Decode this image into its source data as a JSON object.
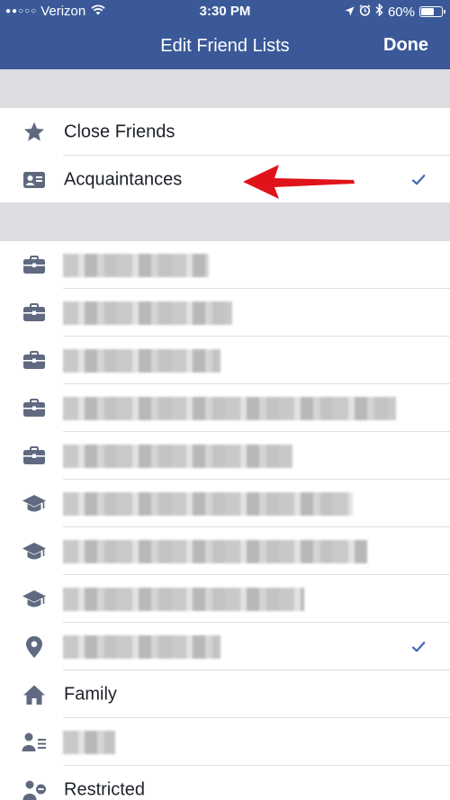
{
  "status_bar": {
    "carrier": "Verizon",
    "time": "3:30 PM",
    "battery": "60%",
    "battery_level": 0.6,
    "icons": [
      "signal-dots-icon",
      "wifi-icon",
      "location-icon",
      "alarm-icon",
      "bluetooth-icon",
      "battery-icon"
    ]
  },
  "nav": {
    "title": "Edit Friend Lists",
    "done_label": "Done",
    "bar_color": "#3b5998"
  },
  "section1": {
    "rows": [
      {
        "label": "Close Friends",
        "icon": "star-icon",
        "checked": false
      },
      {
        "label": "Acquaintances",
        "icon": "contact-card-icon",
        "checked": true
      }
    ]
  },
  "section2": {
    "rows": [
      {
        "label": "",
        "icon": "briefcase-icon",
        "checked": false,
        "blurred": true
      },
      {
        "label": "",
        "icon": "briefcase-icon",
        "checked": false,
        "blurred": true
      },
      {
        "label": "",
        "icon": "briefcase-icon",
        "checked": false,
        "blurred": true
      },
      {
        "label": "",
        "icon": "briefcase-icon",
        "checked": false,
        "blurred": true
      },
      {
        "label": "",
        "icon": "briefcase-icon",
        "checked": false,
        "blurred": true
      },
      {
        "label": "",
        "icon": "graduation-cap-icon",
        "checked": false,
        "blurred": true
      },
      {
        "label": "",
        "icon": "graduation-cap-icon",
        "checked": false,
        "blurred": true
      },
      {
        "label": "",
        "icon": "graduation-cap-icon",
        "checked": false,
        "blurred": true
      },
      {
        "label": "",
        "icon": "location-pin-icon",
        "checked": true,
        "blurred": true
      },
      {
        "label": "Family",
        "icon": "home-icon",
        "checked": false
      },
      {
        "label": "",
        "icon": "person-list-icon",
        "checked": false,
        "blurred": true
      },
      {
        "label": "Restricted",
        "icon": "person-restricted-icon",
        "checked": false
      }
    ]
  },
  "colors": {
    "accent": "#3b5998",
    "check": "#4267b2",
    "icon_gray": "#5f6a80",
    "arrow": "#e0121a"
  }
}
